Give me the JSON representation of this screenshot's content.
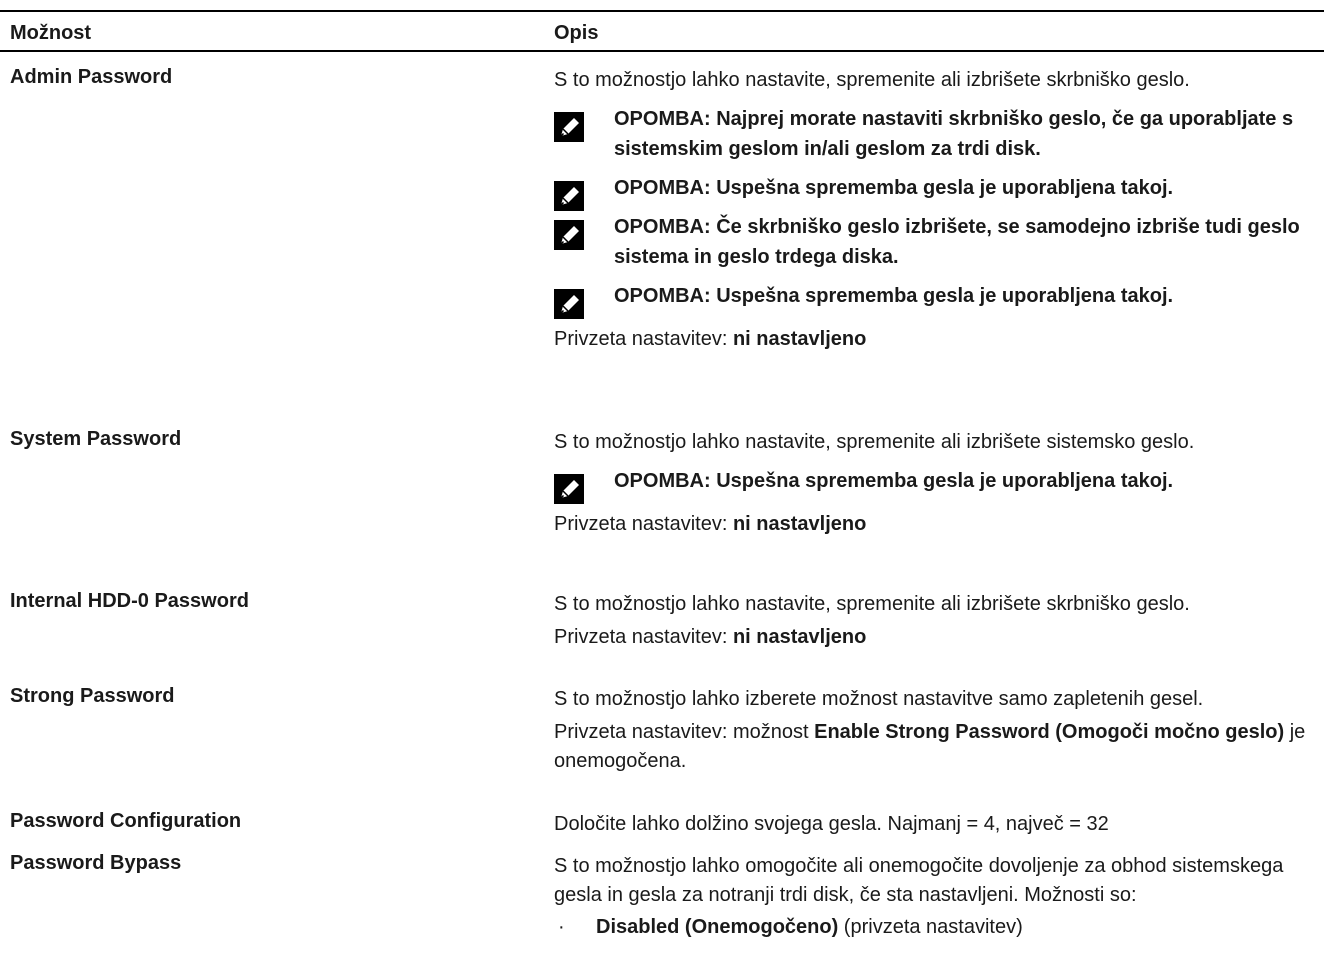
{
  "header": {
    "col_option": "Možnost",
    "col_description": "Opis"
  },
  "note_icon": "pencil-note-icon",
  "rows": {
    "admin": {
      "option": "Admin Password",
      "desc": "S to možnostjo lahko nastavite, spremenite ali izbrišete skrbniško geslo.",
      "notes": [
        "OPOMBA: Najprej morate nastaviti skrbniško geslo, če ga uporabljate s sistemskim geslom in/ali geslom za trdi disk.",
        "OPOMBA: Uspešna sprememba gesla je uporabljena takoj.",
        "OPOMBA: Če skrbniško geslo izbrišete, se samodejno izbriše tudi geslo sistema in geslo trdega diska.",
        "OPOMBA: Uspešna sprememba gesla je uporabljena takoj."
      ],
      "default_label": "Privzeta nastavitev: ",
      "default_value": "ni nastavljeno"
    },
    "system": {
      "option": "System Password",
      "desc": "S to možnostjo lahko nastavite, spremenite ali izbrišete sistemsko geslo.",
      "notes": [
        "OPOMBA: Uspešna sprememba gesla je uporabljena takoj."
      ],
      "default_label": "Privzeta nastavitev: ",
      "default_value": "ni nastavljeno"
    },
    "hdd": {
      "option": "Internal HDD-0 Password",
      "desc": "S to možnostjo lahko nastavite, spremenite ali izbrišete skrbniško geslo.",
      "default_label": "Privzeta nastavitev: ",
      "default_value": "ni nastavljeno"
    },
    "strong": {
      "option": "Strong Password",
      "desc": "S to možnostjo lahko izberete možnost nastavitve samo zapletenih gesel.",
      "default_label": "Privzeta nastavitev: možnost ",
      "default_value": "Enable Strong Password (Omogoči močno geslo)",
      "default_suffix": " je onemogočena."
    },
    "config": {
      "option": "Password Configuration",
      "desc": "Določite lahko dolžino svojega gesla. Najmanj = 4, največ = 32"
    },
    "bypass": {
      "option": "Password Bypass",
      "desc": "S to možnostjo lahko omogočite ali onemogočite dovoljenje za obhod sistemskega gesla in gesla za notranji trdi disk, če sta nastavljeni. Možnosti so:",
      "bullet_dot": "·",
      "bullet_bold": "Disabled (Onemogočeno)",
      "bullet_rest": " (privzeta nastavitev)"
    }
  }
}
